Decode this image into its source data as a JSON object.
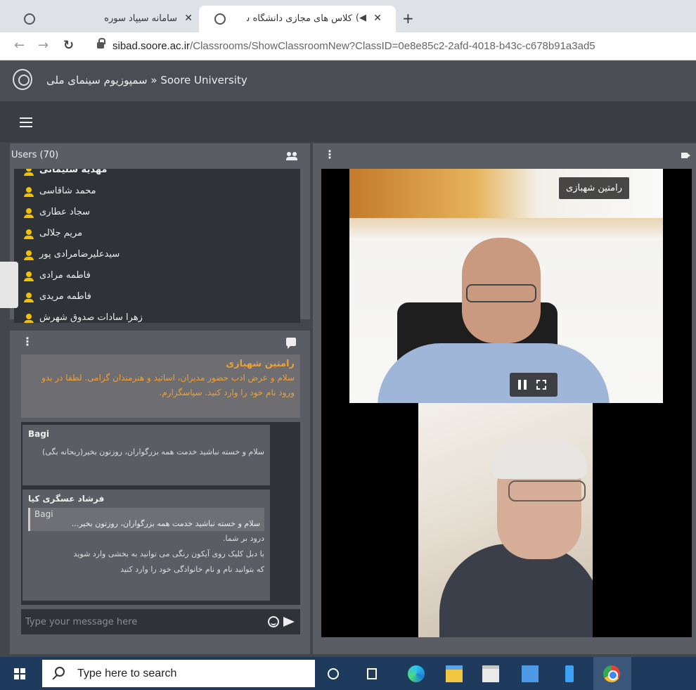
{
  "browser": {
    "tabs": [
      {
        "title": "سامانه سیپاد سوره",
        "active": false
      },
      {
        "title": "کلاس های مجازی دانشگاه سو",
        "active": true
      }
    ],
    "new_tab_symbol": "+",
    "close_symbol": "✕",
    "url_host": "sibad.soore.ac.ir",
    "url_path": "/Classrooms/ShowClassroomNew?ClassID=0e8e85c2-2afd-4018-b43c-c678b91a3ad5"
  },
  "header": {
    "title": "سمپوزیوم سینمای ملی » Soore University"
  },
  "users": {
    "title": "Users (70)",
    "list": [
      "مهدیه سلیمانی",
      "محمد شاقاسی",
      "سجاد عطاری",
      "مریم جلالی",
      "سیدعلیرضامرادی پور",
      "فاطمه مرادی",
      "فاطمه مریدی",
      "زهرا سادات صدوق شهرش"
    ]
  },
  "chat": {
    "pinned": {
      "author": "رامتین شهبازی",
      "text": "سلام و عرض ادب حضور مدیران، اساتید و هنرمندان گرامی. لطفا در بدو ورود نام خود را وارد کنید. سپاسگزارم."
    },
    "messages": [
      {
        "author": "Bagi",
        "text": "سلام و خسته نباشید خدمت همه بزرگواران، روزتون بخیر(ریحانه بگی)"
      },
      {
        "author": "فرشاد عسگری کیا",
        "quote_author": "Bagi",
        "quote_text": "سلام و خسته نباشید خدمت همه بزرگواران، روزتون بخیر...",
        "lines": [
          "درود بر شما.",
          "با دبل کلیک روی آیکون رنگی می توانید به بخشی وارد شوید",
          "که بتوانید نام و نام خانوادگی خود را وارد کنید"
        ]
      }
    ],
    "input_placeholder": "Type your message here"
  },
  "video": {
    "speaker_name": "رامتین شهبازی"
  },
  "taskbar": {
    "search_placeholder": "Type here to search"
  },
  "colors": {
    "accent_orange": "#f0a030",
    "user_icon": "#f2c200",
    "panel": "#5a5d63",
    "panel_dark": "#2f3236"
  }
}
